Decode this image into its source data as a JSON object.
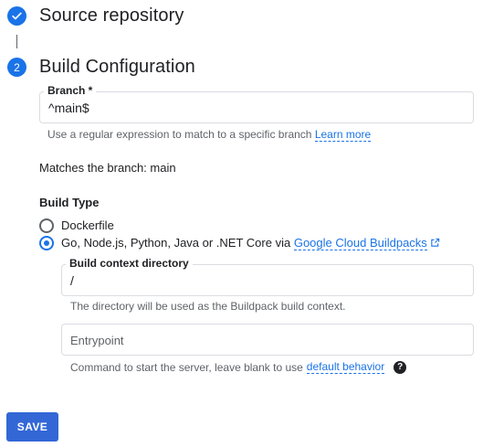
{
  "steps": {
    "source": {
      "title": "Source repository",
      "state": "complete",
      "icon": "check-icon"
    },
    "build": {
      "number": "2",
      "title": "Build Configuration"
    }
  },
  "branch": {
    "label": "Branch *",
    "value": "^main$",
    "helper": "Use a regular expression to match to a specific branch",
    "helper_link": "Learn more",
    "matches": "Matches the branch: main"
  },
  "build_type": {
    "title": "Build Type",
    "options": [
      {
        "label": "Dockerfile",
        "selected": false
      },
      {
        "label": "Go, Node.js, Python, Java or .NET Core via",
        "link": "Google Cloud Buildpacks",
        "link_icon": "external-link-icon",
        "selected": true
      }
    ]
  },
  "context_dir": {
    "label": "Build context directory",
    "value": "/",
    "helper": "The directory will be used as the Buildpack build context."
  },
  "entrypoint": {
    "placeholder": "Entrypoint",
    "helper": "Command to start the server, leave blank to use",
    "helper_link": "default behavior",
    "help_icon": "help-icon"
  },
  "save_label": "SAVE",
  "colors": {
    "accent": "#1a73e8",
    "save_button": "#3367d6",
    "text": "#202124",
    "helper_text": "#5f6368",
    "border": "#dadce0"
  }
}
